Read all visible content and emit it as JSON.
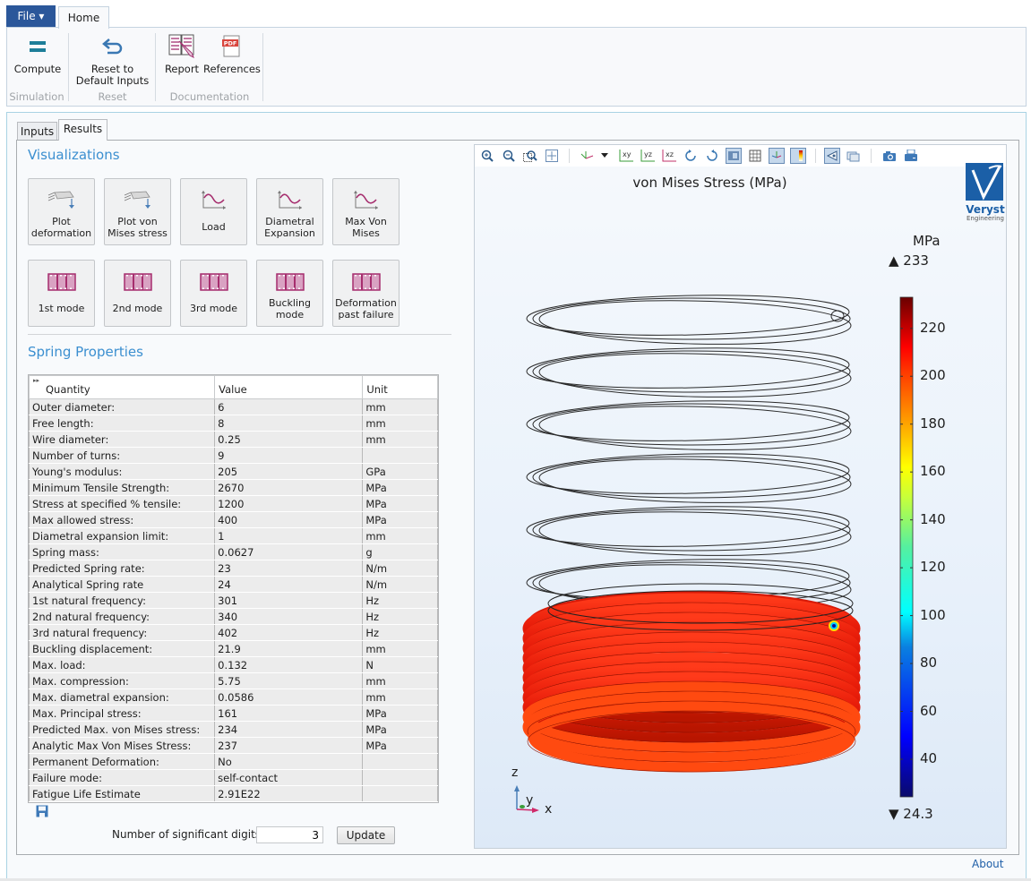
{
  "ribbon": {
    "file_label": "File ▾",
    "home_tab": "Home",
    "groups": [
      {
        "label": "Simulation",
        "buttons": [
          {
            "label": "Compute",
            "icon": "equals-icon"
          }
        ]
      },
      {
        "label": "Reset",
        "buttons": [
          {
            "label": "Reset to Default Inputs",
            "line1": "Reset to",
            "line2": "Default Inputs",
            "icon": "undo-arrow-icon"
          }
        ]
      },
      {
        "label": "Documentation",
        "buttons": [
          {
            "label": "Report",
            "icon": "report-book-icon"
          },
          {
            "label": "References",
            "icon": "pdf-icon"
          }
        ]
      }
    ]
  },
  "tabs": {
    "inputs": "Inputs",
    "results": "Results",
    "active": "Results"
  },
  "visualizations": {
    "title": "Visualizations",
    "buttons": [
      {
        "line1": "Plot",
        "line2": "deformation",
        "icon": "beam-deformation-icon"
      },
      {
        "line1": "Plot von",
        "line2": "Mises stress",
        "icon": "beam-deformation-icon"
      },
      {
        "line1": "Load",
        "line2": "",
        "icon": "wave-plot-icon"
      },
      {
        "line1": "Diametral",
        "line2": "Expansion",
        "icon": "wave-plot-icon"
      },
      {
        "line1": "Max Von",
        "line2": "Mises",
        "icon": "wave-plot-icon"
      },
      {
        "line1": "1st mode",
        "line2": "",
        "icon": "film-icon"
      },
      {
        "line1": "2nd mode",
        "line2": "",
        "icon": "film-icon"
      },
      {
        "line1": "3rd mode",
        "line2": "",
        "icon": "film-icon"
      },
      {
        "line1": "Buckling",
        "line2": "mode",
        "icon": "film-icon"
      },
      {
        "line1": "Deformation",
        "line2": "past failure",
        "icon": "film-icon"
      }
    ]
  },
  "spring_properties": {
    "title": "Spring Properties",
    "columns": [
      "Quantity",
      "Value",
      "Unit"
    ],
    "rows": [
      [
        "Outer diameter:",
        "6",
        "mm"
      ],
      [
        "Free length:",
        "8",
        "mm"
      ],
      [
        "Wire diameter:",
        "0.25",
        "mm"
      ],
      [
        "Number of turns:",
        "9",
        ""
      ],
      [
        "Young's modulus:",
        "205",
        "GPa"
      ],
      [
        "Minimum Tensile Strength:",
        "2670",
        "MPa"
      ],
      [
        "Stress at specified % tensile:",
        "1200",
        "MPa"
      ],
      [
        "Max allowed stress:",
        "400",
        "MPa"
      ],
      [
        "Diametral expansion limit:",
        "1",
        "mm"
      ],
      [
        "Spring mass:",
        "0.0627",
        "g"
      ],
      [
        "Predicted Spring rate:",
        "23",
        "N/m"
      ],
      [
        "Analytical Spring rate",
        "24",
        "N/m"
      ],
      [
        "1st natural frequency:",
        "301",
        "Hz"
      ],
      [
        "2nd natural frequency:",
        "340",
        "Hz"
      ],
      [
        "3rd natural frequency:",
        "402",
        "Hz"
      ],
      [
        "Buckling displacement:",
        "21.9",
        "mm"
      ],
      [
        "Max. load:",
        "0.132",
        "N"
      ],
      [
        "Max. compression:",
        "5.75",
        "mm"
      ],
      [
        "Max. diametral expansion:",
        "0.0586",
        "mm"
      ],
      [
        "Max. Principal stress:",
        "161",
        "MPa"
      ],
      [
        "Predicted Max. von Mises stress:",
        "234",
        "MPa"
      ],
      [
        "Analytic Max Von Mises Stress:",
        "237",
        "MPa"
      ],
      [
        "Permanent Deformation:",
        "No",
        ""
      ],
      [
        "Failure mode:",
        "self-contact",
        ""
      ],
      [
        "Fatigue Life Estimate",
        "2.91E22",
        ""
      ]
    ],
    "sig_digits_label": "Number of significant digits:",
    "sig_digits_value": "3",
    "update_label": "Update"
  },
  "graphics": {
    "toolbar": [
      "zoom-in-icon",
      "zoom-out-icon",
      "zoom-box-icon",
      "zoom-extents-icon",
      "view-axes-icon",
      "dropdown-arrow-icon",
      "xy-view-icon",
      "yz-view-icon",
      "xz-view-icon",
      "rotate-cw-icon",
      "rotate-ccw-icon",
      "scene-light-icon",
      "grid-icon",
      "axis-orientation-icon",
      "color-legend-icon",
      "perspective-icon",
      "wireframe-icon",
      "camera-icon",
      "print-icon"
    ],
    "plot_title": "von Mises Stress (MPa)",
    "logo_name": "Veryst",
    "logo_sub": "Engineering",
    "legend": {
      "unit": "MPa",
      "max": "▲ 233",
      "min": "▼ 24.3",
      "ticks": [
        "220",
        "200",
        "180",
        "160",
        "140",
        "120",
        "100",
        "80",
        "60",
        "40"
      ],
      "range": [
        24.3,
        233
      ],
      "tick_values": [
        220,
        200,
        180,
        160,
        140,
        120,
        100,
        80,
        60,
        40
      ]
    },
    "axes": {
      "z": "z",
      "y": "y",
      "x": "x"
    }
  },
  "footer": {
    "about": "About"
  }
}
